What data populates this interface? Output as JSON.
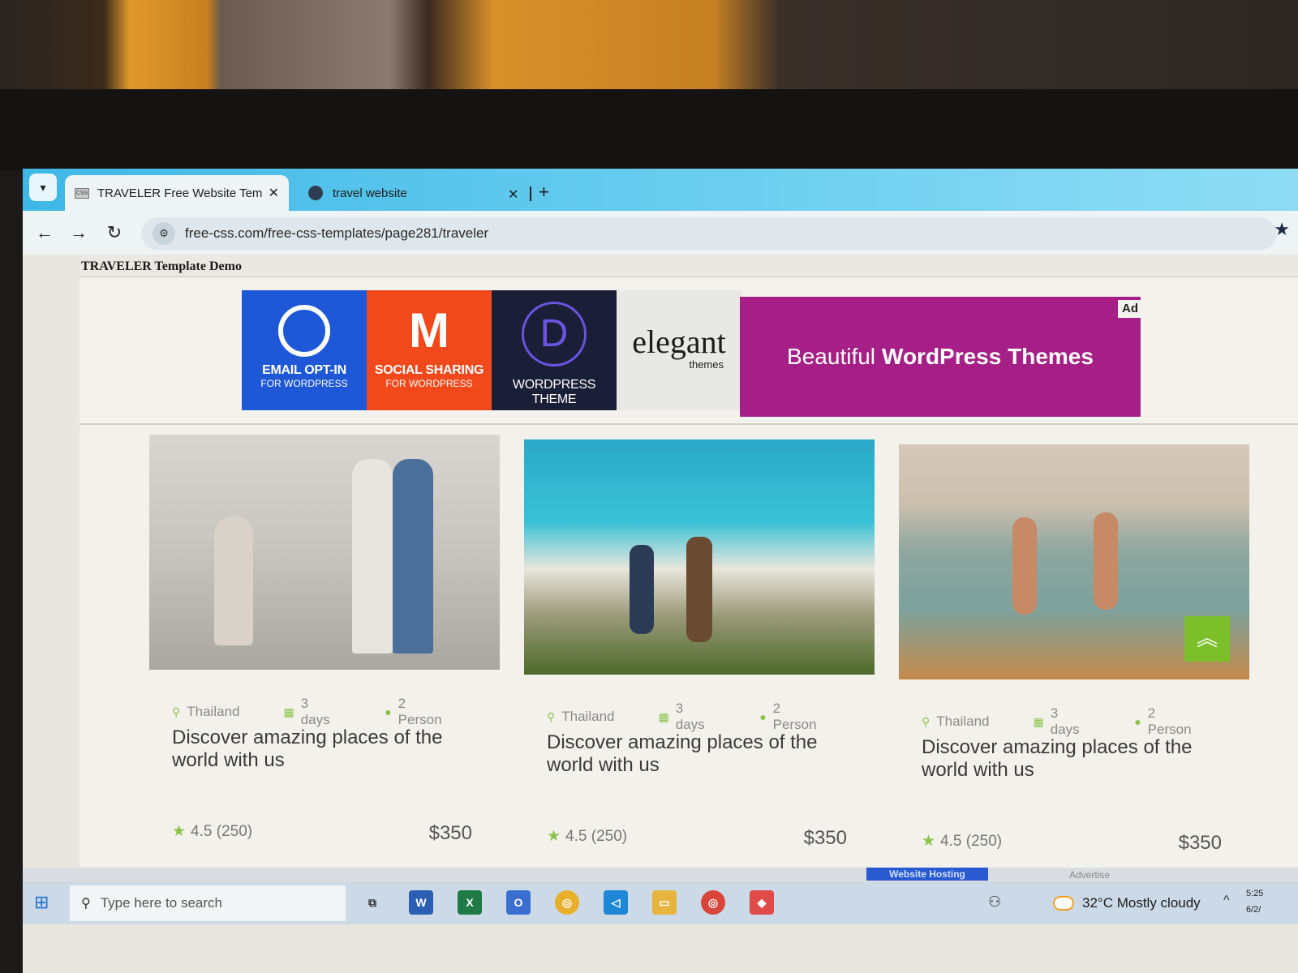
{
  "browser": {
    "tabs": [
      {
        "label": "TRAVELER Free Website Templa",
        "active": true
      },
      {
        "label": "travel website",
        "active": false
      }
    ],
    "url": "free-css.com/free-css-templates/page281/traveler"
  },
  "page": {
    "demo_title": "TRAVELER Template Demo",
    "ad": {
      "tiles": [
        {
          "big": "EMAIL OPT-IN",
          "small": "FOR WORDPRESS"
        },
        {
          "big": "SOCIAL SHARING",
          "small": "FOR WORDPRESS"
        },
        {
          "big": "WORDPRESS THEME",
          "small": ""
        },
        {
          "big": "elegant",
          "small": "themes"
        }
      ],
      "banner_prefix": "Beautiful",
      "banner_bold": "WordPress Themes",
      "label": "Ad"
    },
    "cards": [
      {
        "location": "Thailand",
        "duration": "3 days",
        "people": "2 Person",
        "title": "Discover amazing places of the world with us",
        "rating": "4.5",
        "reviews": "(250)",
        "price": "$350"
      },
      {
        "location": "Thailand",
        "duration": "3 days",
        "people": "2 Person",
        "title": "Discover amazing places of the world with us",
        "rating": "4.5",
        "reviews": "(250)",
        "price": "$350"
      },
      {
        "location": "Thailand",
        "duration": "3 days",
        "people": "2 Person",
        "title": "Discover amazing places of the world with us",
        "rating": "4.5",
        "reviews": "(250)",
        "price": "$350"
      }
    ],
    "hosting_label": "Website Hosting",
    "advertise_label": "Advertise"
  },
  "taskbar": {
    "search_placeholder": "Type here to search",
    "weather": "32°C  Mostly cloudy",
    "time": "5:25",
    "date": "6/2/"
  },
  "colors": {
    "accent": "#8bc34a",
    "banner": "#a51f86",
    "tab_strip": "#3fb8e6"
  }
}
